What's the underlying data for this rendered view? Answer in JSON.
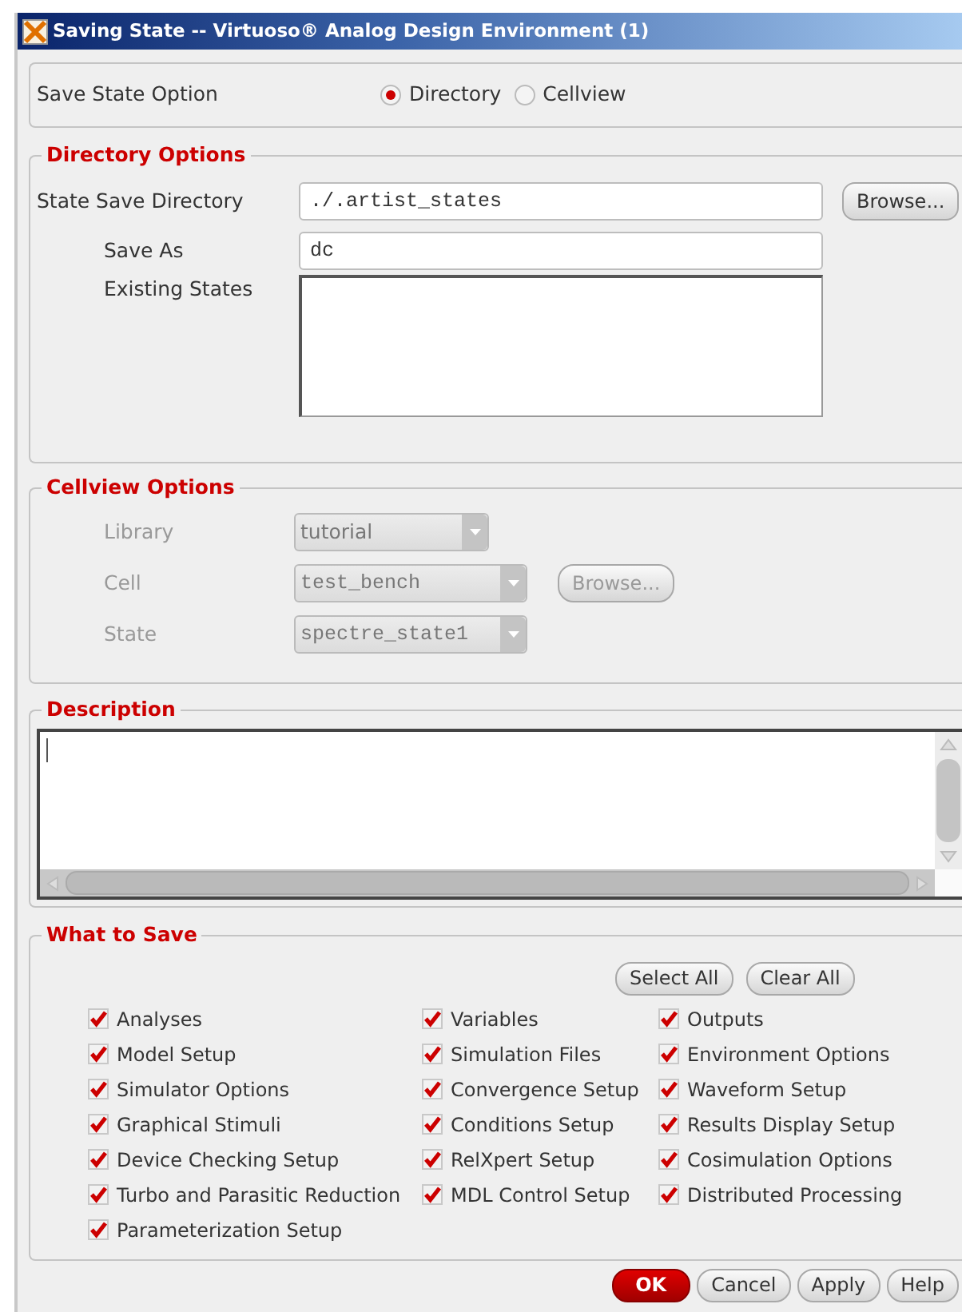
{
  "window": {
    "title": "Saving State -- Virtuoso® Analog Design Environment (1)"
  },
  "save_state_option": {
    "label": "Save State Option",
    "options": [
      {
        "label": "Directory",
        "selected": true
      },
      {
        "label": "Cellview",
        "selected": false
      }
    ]
  },
  "directory_options": {
    "title": "Directory Options",
    "state_save_directory": {
      "label": "State Save Directory",
      "value": "./.artist_states"
    },
    "browse_button": "Browse...",
    "save_as": {
      "label": "Save As",
      "value": "dc"
    },
    "existing_states": {
      "label": "Existing States"
    }
  },
  "cellview_options": {
    "title": "Cellview Options",
    "disabled": true,
    "library": {
      "label": "Library",
      "value": "tutorial"
    },
    "cell": {
      "label": "Cell",
      "value": "test_bench"
    },
    "browse_button": "Browse...",
    "state": {
      "label": "State",
      "value": "spectre_state1"
    }
  },
  "description": {
    "title": "Description"
  },
  "what_to_save": {
    "title": "What to Save",
    "select_all": "Select All",
    "clear_all": "Clear All",
    "items": [
      {
        "label": "Analyses",
        "checked": true
      },
      {
        "label": "Variables",
        "checked": true
      },
      {
        "label": "Outputs",
        "checked": true
      },
      {
        "label": "Model Setup",
        "checked": true
      },
      {
        "label": "Simulation Files",
        "checked": true
      },
      {
        "label": "Environment Options",
        "checked": true
      },
      {
        "label": "Simulator Options",
        "checked": true
      },
      {
        "label": "Convergence Setup",
        "checked": true
      },
      {
        "label": "Waveform Setup",
        "checked": true
      },
      {
        "label": "Graphical Stimuli",
        "checked": true
      },
      {
        "label": "Conditions Setup",
        "checked": true
      },
      {
        "label": "Results Display Setup",
        "checked": true
      },
      {
        "label": "Device Checking Setup",
        "checked": true
      },
      {
        "label": "RelXpert Setup",
        "checked": true
      },
      {
        "label": "Cosimulation Options",
        "checked": true
      },
      {
        "label": "Turbo and Parasitic Reduction",
        "checked": true
      },
      {
        "label": "MDL Control Setup",
        "checked": true
      },
      {
        "label": "Distributed Processing",
        "checked": true
      },
      {
        "label": "Parameterization Setup",
        "checked": true
      }
    ]
  },
  "buttons": [
    {
      "label": "OK",
      "kind": "default"
    },
    {
      "label": "Cancel",
      "kind": "normal"
    },
    {
      "label": "Apply",
      "kind": "normal"
    },
    {
      "label": "Help",
      "kind": "normal"
    }
  ]
}
